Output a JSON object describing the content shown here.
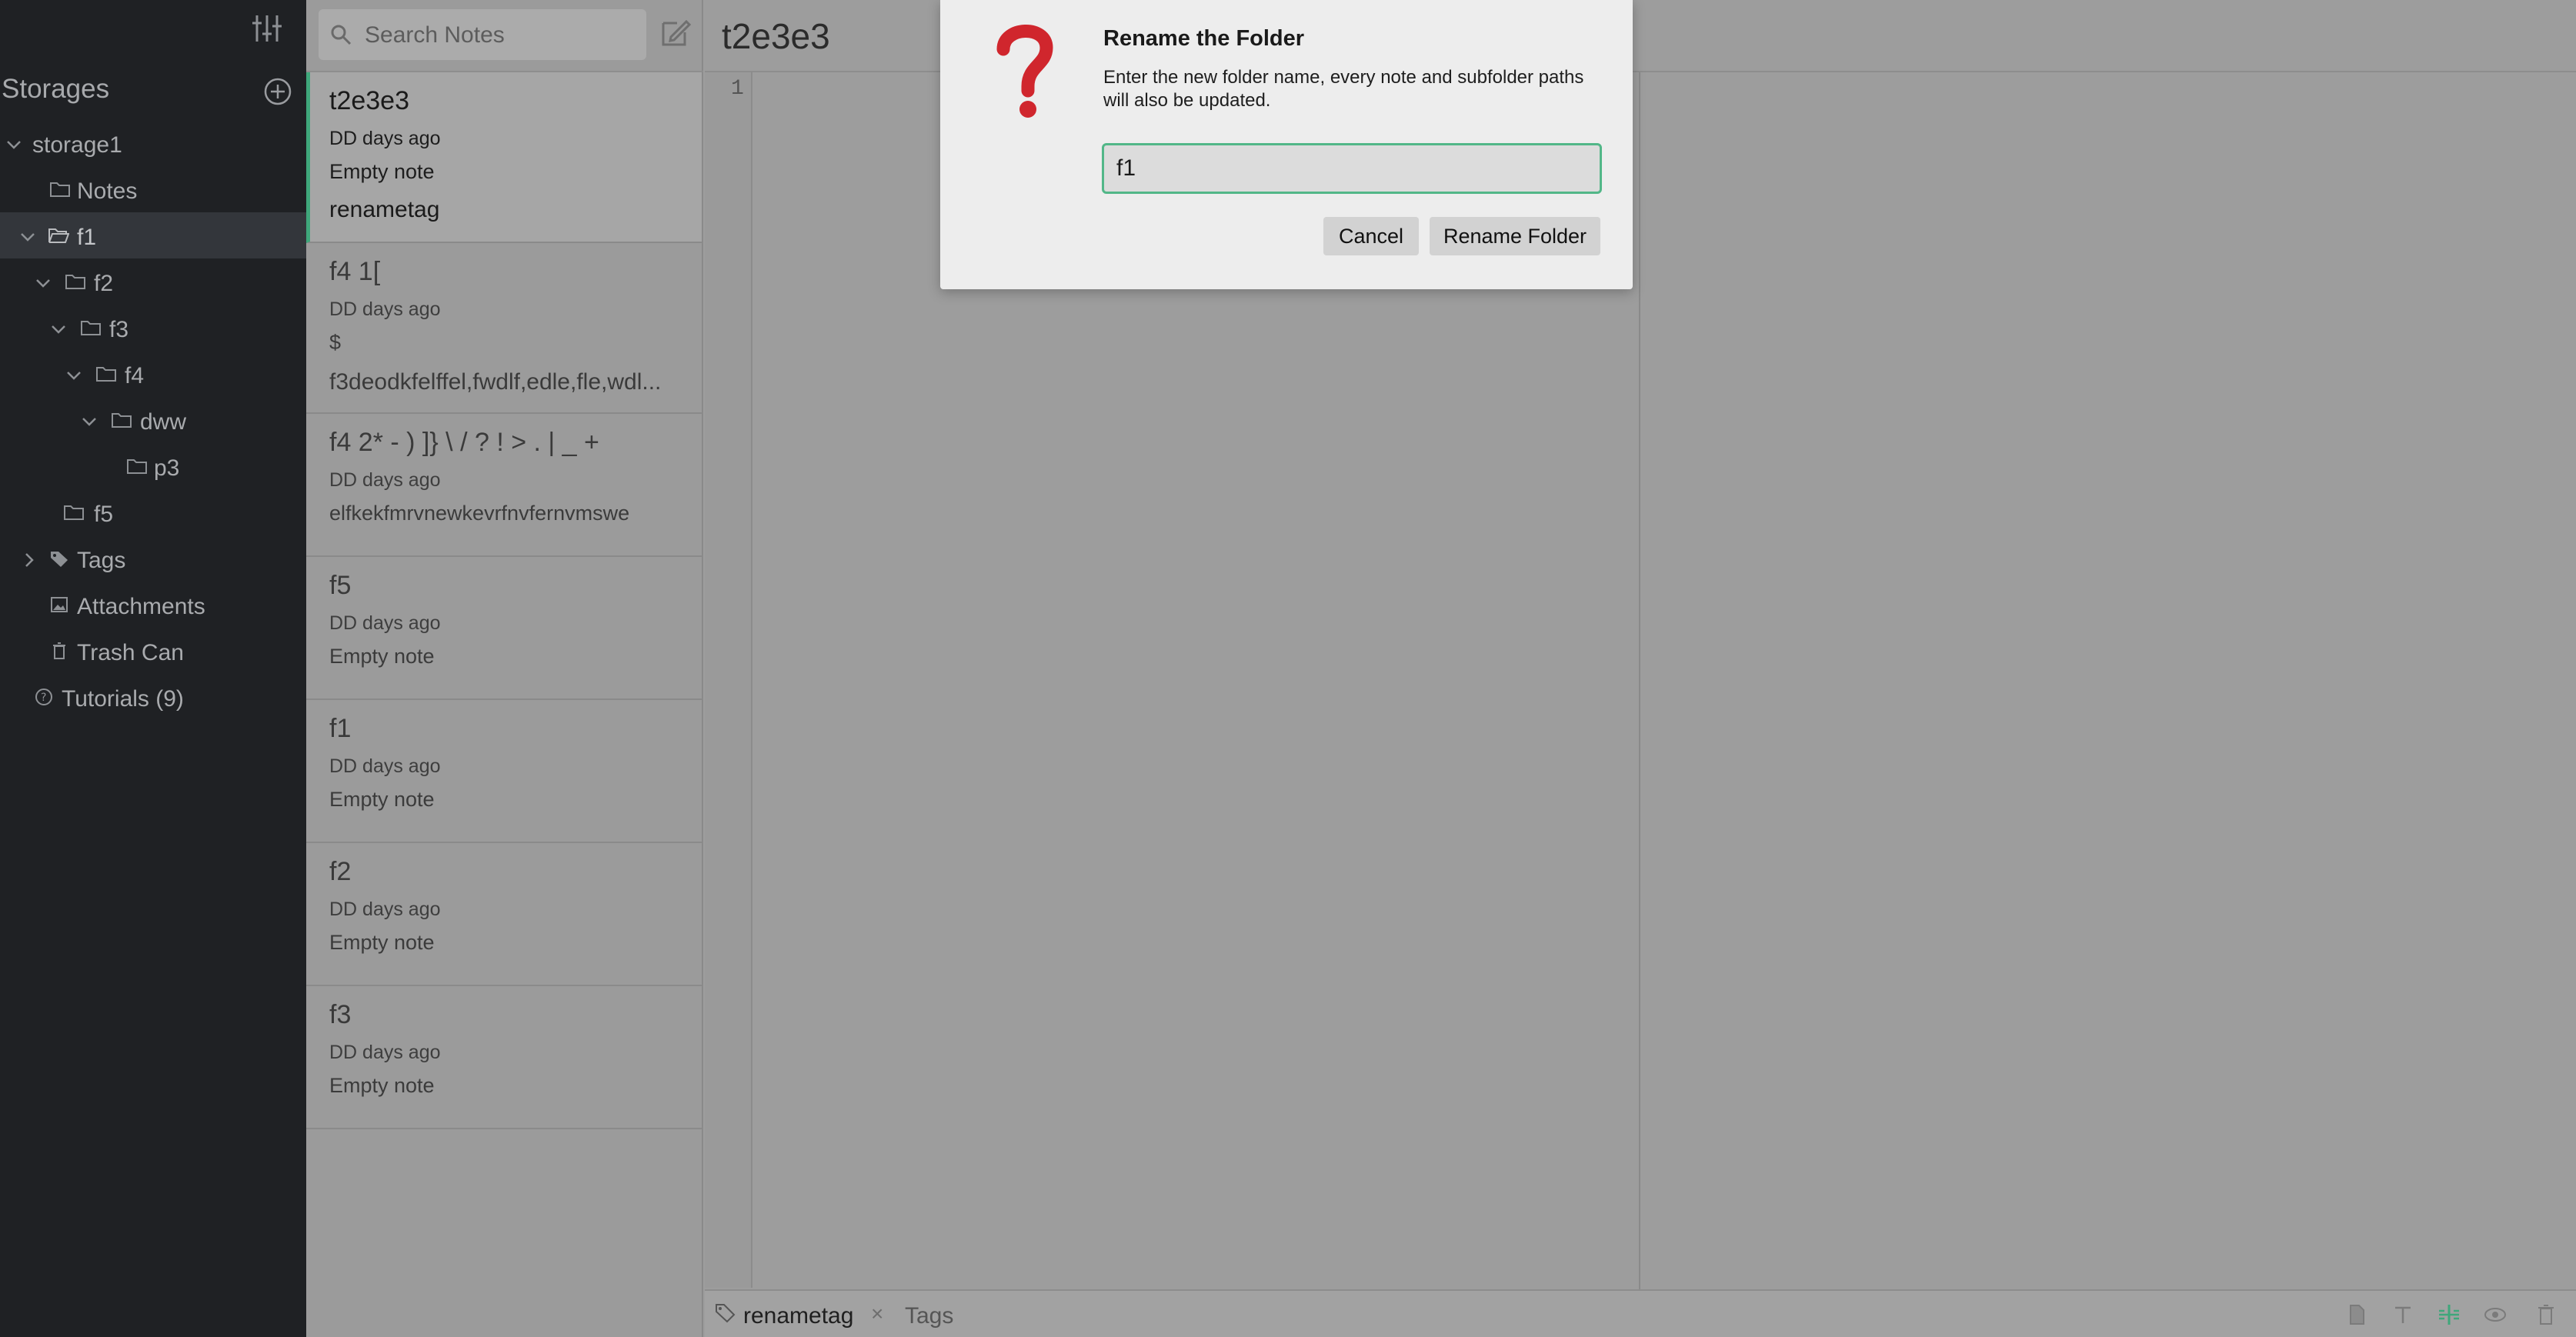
{
  "sidebar": {
    "storages_label": "Storages",
    "tree": [
      {
        "label": "storage1",
        "icon": "chevron-down-icon",
        "name": "storage-item-storage1"
      },
      {
        "label": "Notes",
        "icon": "folder-icon",
        "name": "folder-item-notes"
      },
      {
        "label": "f1",
        "icon": "folder-open-icon",
        "name": "folder-item-f1"
      },
      {
        "label": "f2",
        "icon": "folder-icon",
        "name": "folder-item-f2"
      },
      {
        "label": "f3",
        "icon": "folder-icon",
        "name": "folder-item-f3"
      },
      {
        "label": "f4",
        "icon": "folder-icon",
        "name": "folder-item-f4"
      },
      {
        "label": "dww",
        "icon": "folder-icon",
        "name": "folder-item-dww"
      },
      {
        "label": "p3",
        "icon": "folder-icon",
        "name": "folder-item-p3"
      },
      {
        "label": "f5",
        "icon": "folder-icon",
        "name": "folder-item-f5"
      },
      {
        "label": "Tags",
        "icon": "tags-icon",
        "name": "sidebar-item-tags"
      },
      {
        "label": "Attachments",
        "icon": "image-icon",
        "name": "sidebar-item-attachments"
      },
      {
        "label": "Trash Can",
        "icon": "trash-icon",
        "name": "sidebar-item-trash"
      },
      {
        "label": "Tutorials (9)",
        "icon": "help-icon",
        "name": "sidebar-item-tutorials"
      }
    ]
  },
  "notelist": {
    "search_placeholder": "Search Notes",
    "notes": [
      {
        "title": "t2e3e3",
        "date": "DD days ago",
        "desc": "Empty note",
        "tag": "renametag"
      },
      {
        "title": "f4 1[",
        "date": "DD days ago",
        "desc": "$",
        "desc2": "f3deodkfelffel,fwdlf,edle,fle,wdl..."
      },
      {
        "title": "f4 2* - ) ]} \\ / ? ! > . | _ +",
        "date": "DD days ago",
        "desc": "elfkekfmrvnewkevrfnvfernvmswe"
      },
      {
        "title": "f5",
        "date": "DD days ago",
        "desc": "Empty note"
      },
      {
        "title": "f1",
        "date": "DD days ago",
        "desc": "Empty note"
      },
      {
        "title": "f2",
        "date": "DD days ago",
        "desc": "Empty note"
      },
      {
        "title": "f3",
        "date": "DD days ago",
        "desc": "Empty note"
      }
    ]
  },
  "editor": {
    "title": "t2e3e3",
    "line_number": "1",
    "footer": {
      "tag": "renametag",
      "remove": "×",
      "tags_placeholder": "Tags"
    }
  },
  "dialog": {
    "title": "Rename the Folder",
    "message": "Enter the new folder name, every note and subfolder paths will also be updated.",
    "input_value": "f1",
    "cancel_label": "Cancel",
    "confirm_label": "Rename Folder",
    "accent_color": "#52b788",
    "icon_color": "#d0262d"
  },
  "colors": {
    "sidebar_bg": "#1f2124",
    "selected_accent": "#3fa77b"
  }
}
